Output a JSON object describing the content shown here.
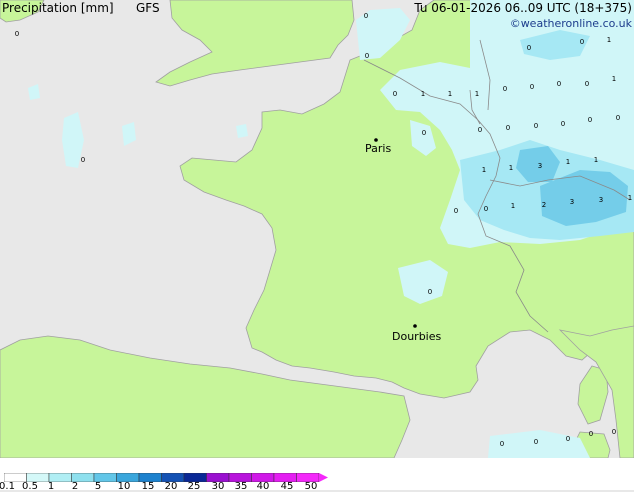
{
  "map": {
    "cities": [
      {
        "name": "Paris"
      },
      {
        "name": "Dourbies"
      }
    ],
    "values": [
      "0",
      "0",
      "0",
      "0",
      "0",
      "1",
      "1",
      "1",
      "0",
      "0",
      "0",
      "1",
      "0",
      "0",
      "0",
      "1",
      "0",
      "0",
      "0",
      "0",
      "0",
      "0",
      "0",
      "1",
      "1",
      "1",
      "3",
      "1",
      "0",
      "0",
      "1",
      "2",
      "3",
      "3",
      "1",
      "0",
      "0",
      "0",
      "0",
      "0",
      "0"
    ]
  },
  "legend": {
    "title": "Precipitation [mm]",
    "model": "GFS",
    "datetime": "Tu 06-01-2026 06..09 UTC (18+375)",
    "credit": "©weatheronline.co.uk",
    "scale_labels": [
      "0.1",
      "0.5",
      "1",
      "2",
      "5",
      "10",
      "15",
      "20",
      "25",
      "30",
      "35",
      "40",
      "45",
      "50"
    ],
    "scale_colors": [
      "#ffffff",
      "#d4f8f8",
      "#b0eef4",
      "#8ee0ee",
      "#62c6e8",
      "#3aa6dc",
      "#1e82ce",
      "#1452b4",
      "#0a2896",
      "#9a10d0",
      "#b814dc",
      "#d018e8",
      "#e41ef2",
      "#f428fa"
    ],
    "colors": {
      "sea": "#e8e8e8",
      "land": "#c7f59a",
      "border": "#a0a0a0",
      "precip_light": "#d0f6f8",
      "precip_mid": "#a6e8f4",
      "precip_strong": "#74cde9"
    }
  }
}
